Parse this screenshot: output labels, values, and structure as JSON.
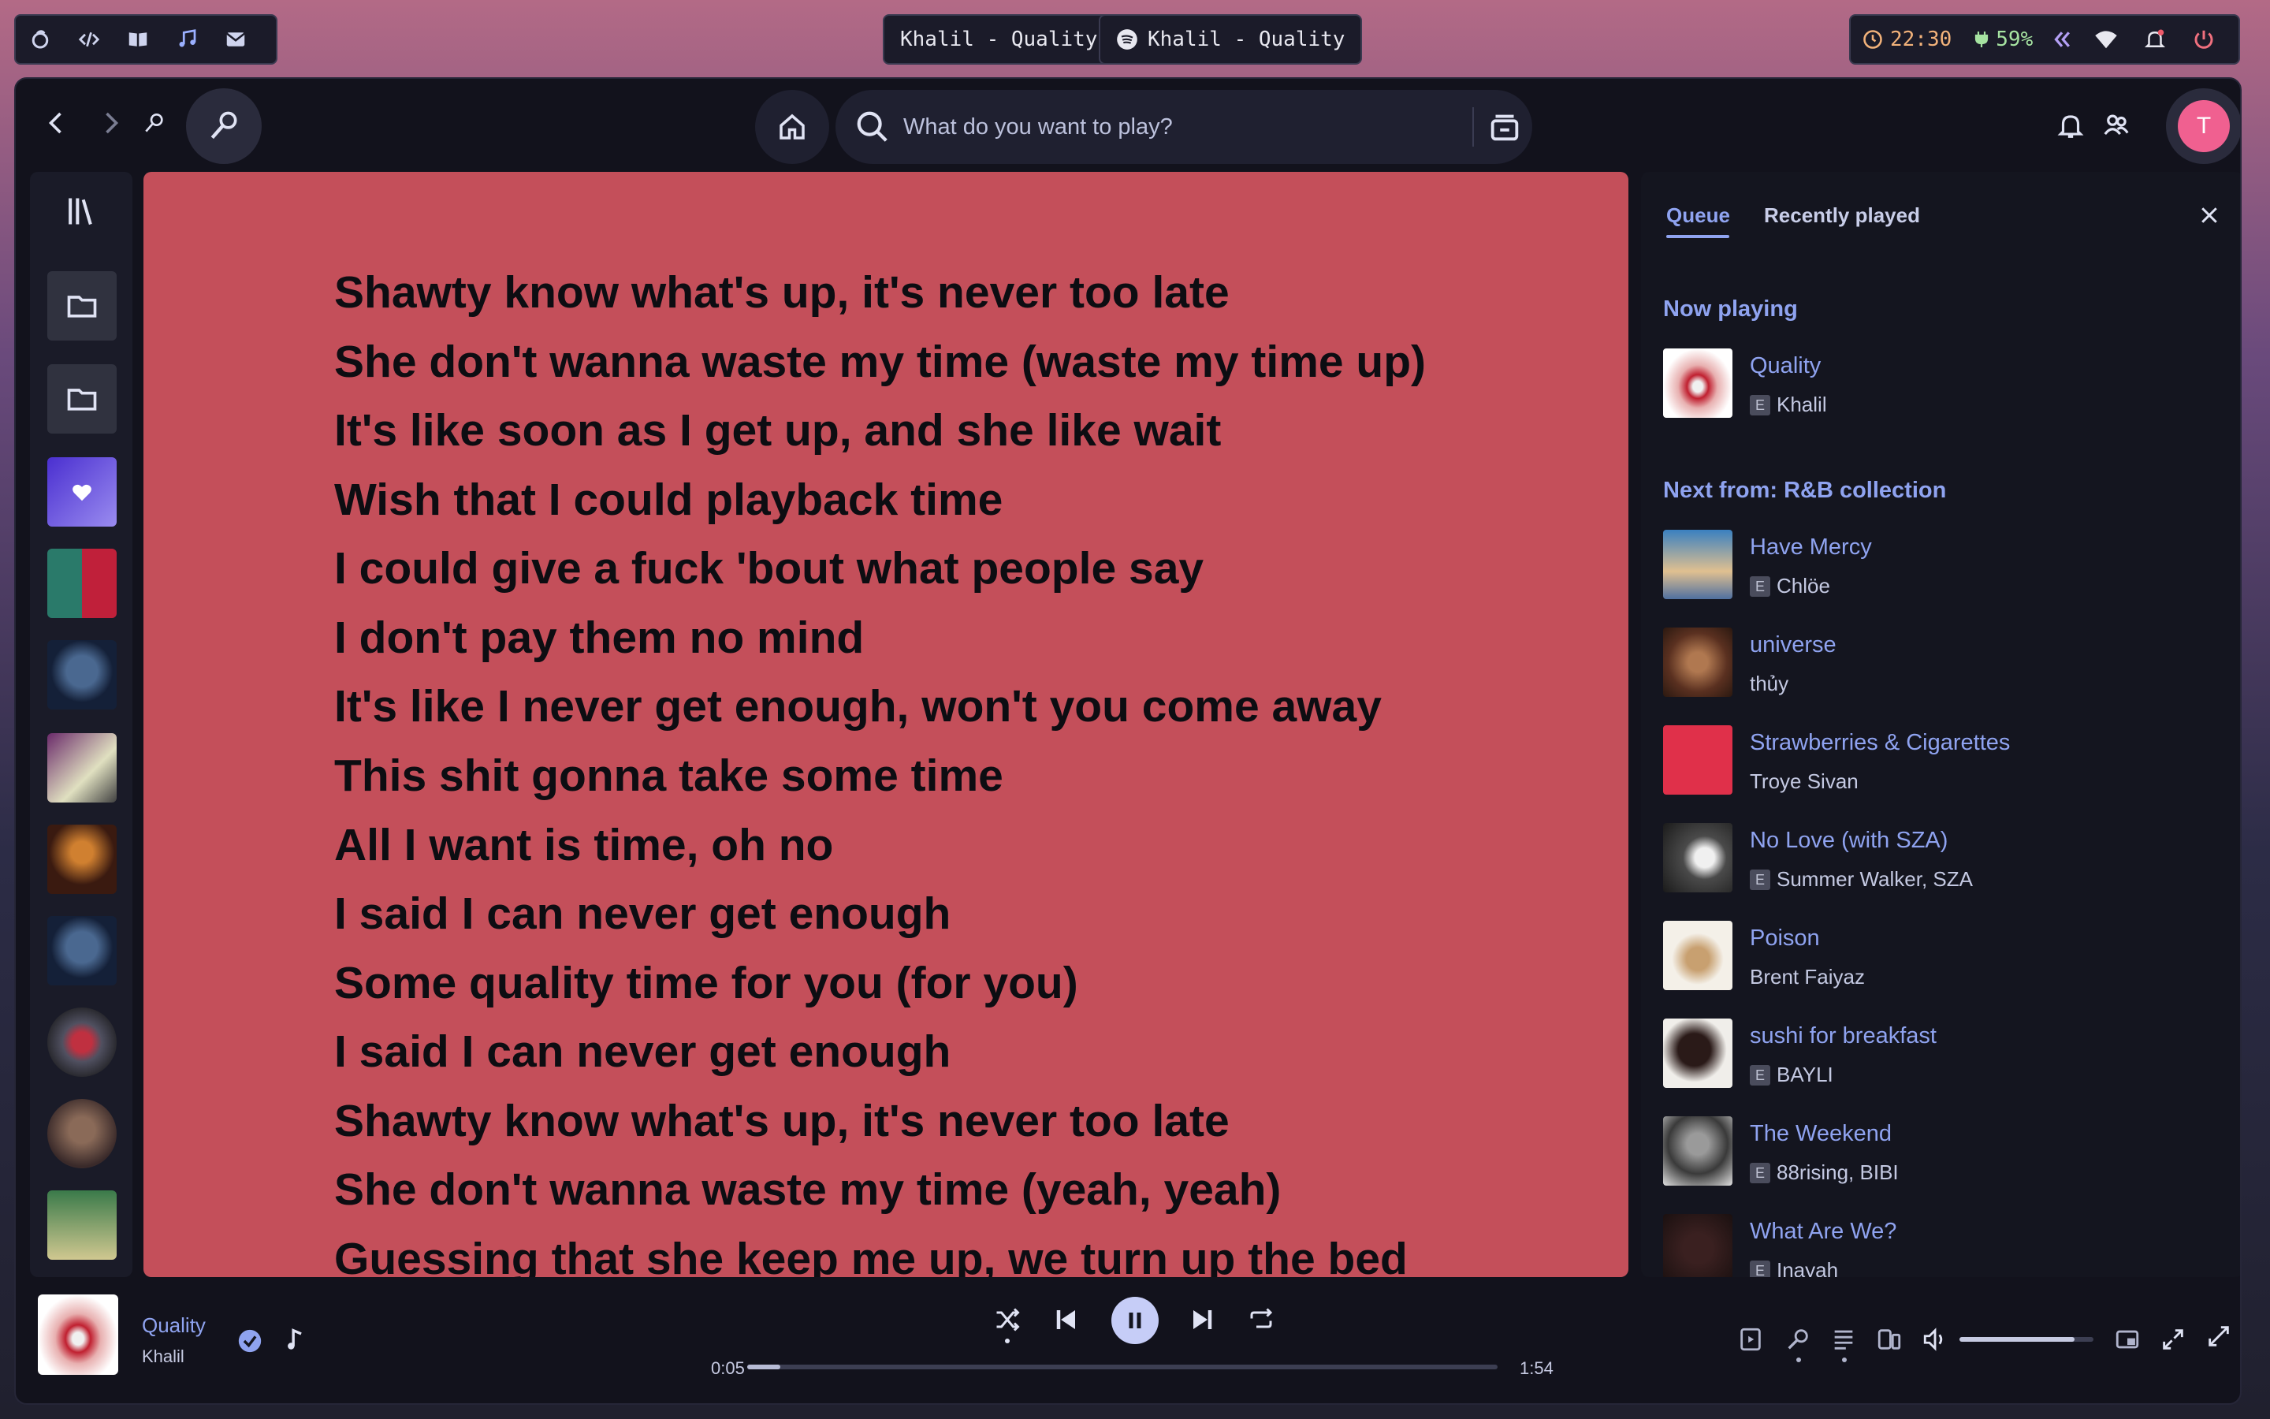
{
  "taskbar": {
    "window_titles": [
      "Khalil - Quality",
      "Khalil - Quality"
    ],
    "clock": "22:30",
    "battery": "59%"
  },
  "search": {
    "placeholder": "What do you want to play?"
  },
  "profile": {
    "initial": "T"
  },
  "lyrics": [
    "Shawty know what's up, it's never too late",
    "She don't wanna waste my time (waste my time up)",
    "It's like soon as I get up, and she like wait",
    "Wish that I could playback time",
    "I could give a fuck 'bout what people say",
    "I don't pay them no mind",
    "It's like I never get enough, won't you come away",
    "This shit gonna take some time",
    "All I want is time, oh no",
    "I said I can never get enough",
    "Some quality time for you (for you)",
    "I said I can never get enough",
    "Shawty know what's up, it's never too late",
    "She don't wanna waste my time (yeah, yeah)",
    "Guessing that she keep me up, we turn up the bed"
  ],
  "queue": {
    "tabs": [
      "Queue",
      "Recently played"
    ],
    "now_playing_label": "Now playing",
    "now_playing": {
      "title": "Quality",
      "artist": "Khalil",
      "explicit": true
    },
    "next_label": "Next from: R&B collection",
    "badge": "E",
    "items": [
      {
        "title": "Have Mercy",
        "artist": "Chlöe",
        "explicit": true
      },
      {
        "title": "universe",
        "artist": "thủy",
        "explicit": false
      },
      {
        "title": "Strawberries & Cigarettes",
        "artist": "Troye Sivan",
        "explicit": false
      },
      {
        "title": "No Love (with SZA)",
        "artist": "Summer Walker, SZA",
        "explicit": true
      },
      {
        "title": "Poison",
        "artist": "Brent Faiyaz",
        "explicit": false
      },
      {
        "title": "sushi for breakfast",
        "artist": "BAYLI",
        "explicit": true
      },
      {
        "title": "The Weekend",
        "artist": "88rising, BIBI",
        "explicit": true
      },
      {
        "title": "What Are We?",
        "artist": "Inayah",
        "explicit": true
      }
    ]
  },
  "player": {
    "title": "Quality",
    "artist": "Khalil",
    "elapsed": "0:05",
    "duration": "1:54",
    "progress_fraction": 0.044,
    "volume_fraction": 0.86
  },
  "colors": {
    "accent": "#8fa3f0",
    "lyrics_bg": "#c44f5a",
    "panel": "#14151f"
  }
}
